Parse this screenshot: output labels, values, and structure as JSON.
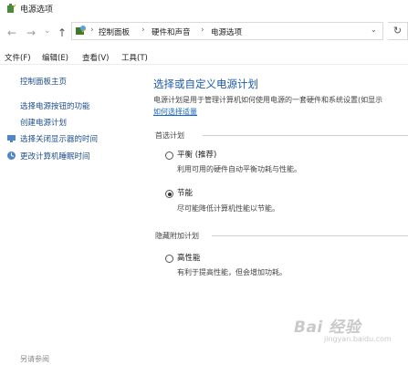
{
  "window": {
    "title": "电源选项"
  },
  "nav": {
    "back": "←",
    "forward": "→",
    "dropdown": "⌄",
    "up": "↑"
  },
  "address": {
    "crumbs": [
      "控制面板",
      "硬件和声音",
      "电源选项"
    ],
    "separator": "›",
    "dropdown": "⌄",
    "refresh": "↻"
  },
  "menu": {
    "file": "文件(F)",
    "edit": "编辑(E)",
    "view": "查看(V)",
    "tools": "工具(T)"
  },
  "left_pane": {
    "home": "控制面板主页",
    "items": [
      "选择电源按钮的功能",
      "创建电源计划",
      "选择关闭显示器的时间",
      "更改计算机睡眠时间"
    ],
    "see_also": "另请参阅"
  },
  "main": {
    "title": "选择或自定义电源计划",
    "description": "电源计划是用于管理计算机如何使用电源的一套硬件和系统设置(如显示",
    "description_link": "如何选择适量",
    "preferred": {
      "label": "首选计划",
      "plans": [
        {
          "name": "平衡 (推荐)",
          "desc": "利用可用的硬件自动平衡功耗与性能。",
          "selected": false
        },
        {
          "name": "节能",
          "desc": "尽可能降低计算机性能以节能。",
          "selected": true
        }
      ]
    },
    "hidden": {
      "label": "隐藏附加计划",
      "plans": [
        {
          "name": "高性能",
          "desc": "有利于提高性能，但会增加功耗。",
          "selected": false
        }
      ]
    }
  },
  "watermark": {
    "brand": "Bai 经验",
    "url": "jingyan.baidu.com"
  },
  "colors": {
    "link": "#1f4e8c",
    "heading": "#1e5aa8"
  }
}
